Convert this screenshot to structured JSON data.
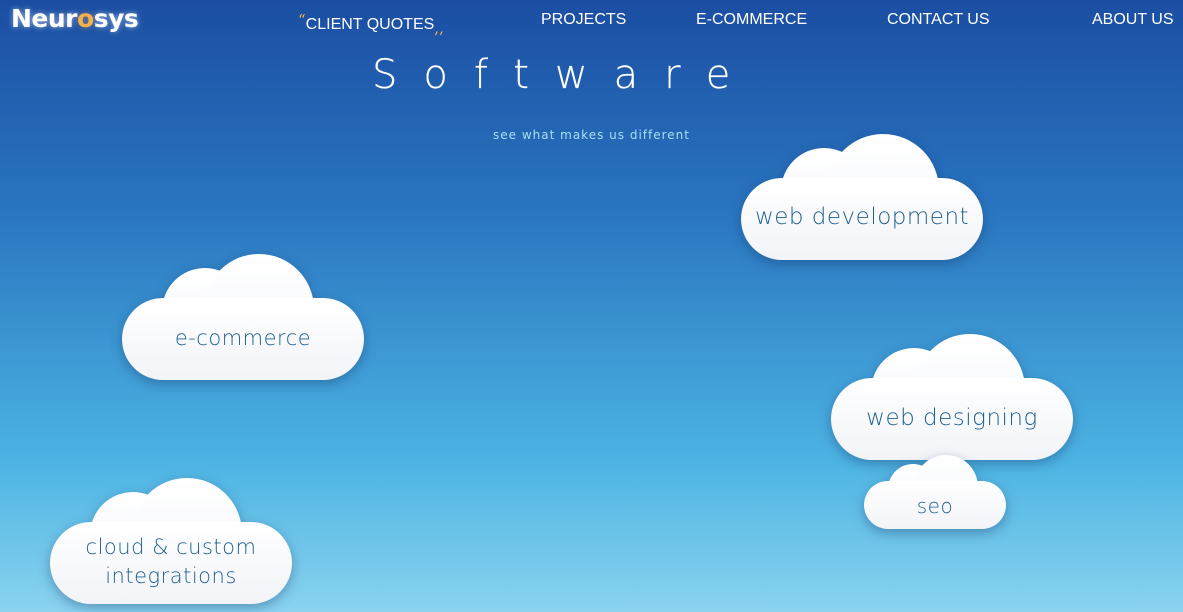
{
  "brand": {
    "logo_part1": "Neur",
    "logo_part2": "o",
    "logo_part3": "sys",
    "accent_color": "#f5b04e"
  },
  "nav": {
    "quote_open": "“",
    "client_quotes": "CLIENT QUOTES",
    "quote_close": ",,",
    "projects": "PROJECTS",
    "ecommerce": "E-COMMERCE",
    "contact": "CONTACT US",
    "about": "ABOUT US"
  },
  "hero": {
    "title": "Software",
    "subtitle": "see what makes us different"
  },
  "clouds": {
    "web_development": "web development",
    "ecommerce": "e-commerce",
    "web_designing": "web designing",
    "seo": "seo",
    "cloud_integrations_line1": "cloud & custom",
    "cloud_integrations_line2": "integrations"
  },
  "colors": {
    "background_top": "#1b4ea3",
    "background_bottom": "#8ad3ef",
    "cloud_text": "#1f5f8f"
  }
}
